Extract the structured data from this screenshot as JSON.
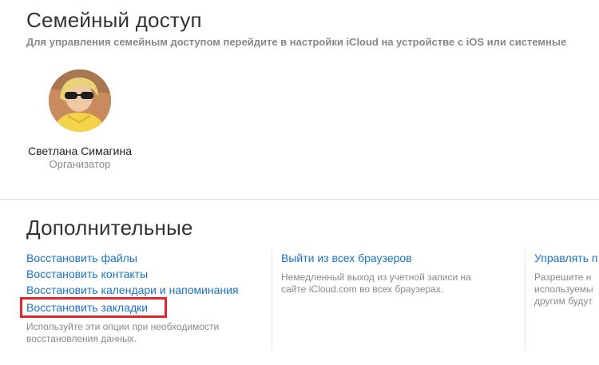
{
  "family": {
    "title": "Семейный доступ",
    "subtitle": "Для управления семейным доступом перейдите в настройки iCloud на устройстве с iOS или системные",
    "member": {
      "name": "Светлана Симагина",
      "role": "Организатор"
    }
  },
  "advanced": {
    "title": "Дополнительные",
    "restore": {
      "links": [
        "Восстановить файлы",
        "Восстановить контакты",
        "Восстановить календари и напоминания",
        "Восстановить закладки"
      ],
      "description": "Используйте эти опции при необходимости\nвосстановления данных."
    },
    "signout": {
      "link": "Выйти из всех браузеров",
      "description": "Немедленный выход из учетной записи на\nсайте iCloud.com во всех браузерах."
    },
    "manage": {
      "link": "Управлять п",
      "description": "Разрешите н\nиспользуемы\nдругим будут"
    }
  },
  "colors": {
    "link": "#1a73c8",
    "highlight": "#e3262a",
    "muted": "#8a8a8a"
  },
  "icons": {
    "avatar": "user-photo"
  }
}
